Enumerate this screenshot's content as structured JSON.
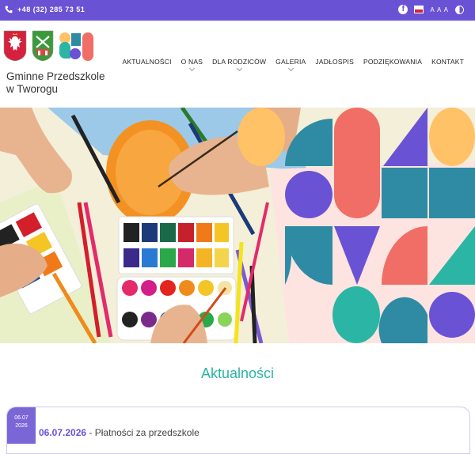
{
  "topbar": {
    "phone": "+48 (32) 285 73 51",
    "facebook_glyph": "f",
    "font_size_label": "A A A",
    "icons": [
      "phone-icon",
      "facebook-icon",
      "flag-icon",
      "contrast-icon"
    ]
  },
  "header": {
    "school_name_line1": "Gminne Przedszkole",
    "school_name_line2": "w Tworogu"
  },
  "nav": {
    "items": [
      {
        "label": "AKTUALNOŚCI",
        "has_submenu": false
      },
      {
        "label": "O NAS",
        "has_submenu": true
      },
      {
        "label": "DLA RODZICÓW",
        "has_submenu": true
      },
      {
        "label": "GALERIA",
        "has_submenu": true
      },
      {
        "label": "JADŁOSPIS",
        "has_submenu": false
      },
      {
        "label": "PODZIĘKOWANIA",
        "has_submenu": false
      },
      {
        "label": "KONTAKT",
        "has_submenu": false
      }
    ]
  },
  "section": {
    "title": "Aktualności"
  },
  "news": [
    {
      "badge_date": "06.07",
      "badge_year": "2026",
      "date": "06.07.2026",
      "separator": " - ",
      "title": "Płatności za przedszkole"
    }
  ],
  "colors": {
    "brand": "#6a52d4",
    "accent": "#2bb5a5",
    "coral": "#f06e66",
    "teal": "#2e8ba3",
    "yellow": "#ffc266",
    "pink_bg": "#fde4e0"
  }
}
